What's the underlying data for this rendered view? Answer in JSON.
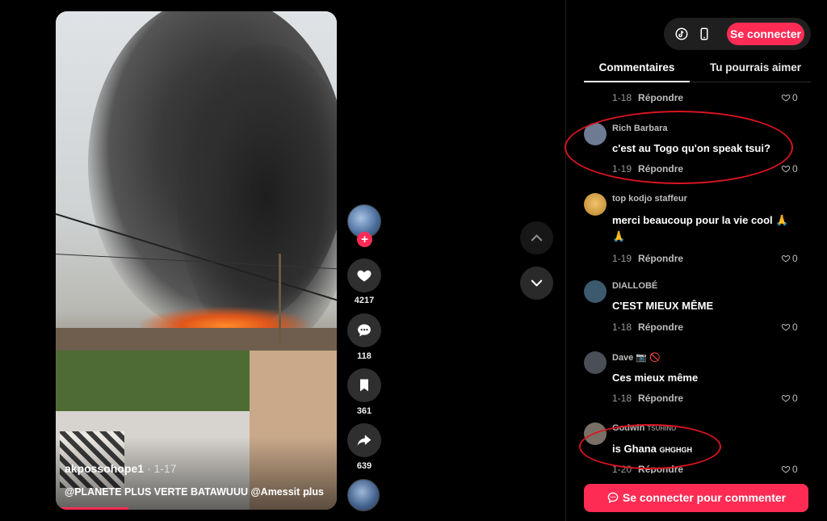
{
  "video": {
    "author": "akpossohope1",
    "date_sep": " · ",
    "date": "1-17",
    "caption": "@PLANETE PLUS VERTE BATAWUUU @Amessit ...",
    "more_label": "plus",
    "progress": 0.26
  },
  "actions": {
    "likes": "4217",
    "comments": "118",
    "saves": "361",
    "shares": "639",
    "follow_symbol": "+"
  },
  "header": {
    "connect_label": "Se connecter"
  },
  "tabs": [
    {
      "label": "Commentaires",
      "active": true
    },
    {
      "label": "Tu pourrais aimer",
      "active": false
    }
  ],
  "partial_top": {
    "date": "1-18",
    "reply": "Répondre",
    "likes": "0"
  },
  "comments": [
    {
      "name": "Rich Barbara",
      "text": "c'est au Togo qu'on speak tsui?",
      "date": "1-19",
      "reply": "Répondre",
      "likes": "0",
      "avatar_color": "#6d7c92"
    },
    {
      "name": "top kodjo staffeur",
      "text": "merci beaucoup pour la vie cool 🙏",
      "text2": "🙏",
      "date": "1-19",
      "reply": "Répondre",
      "likes": "0",
      "avatar_color": "#d9a441"
    },
    {
      "name": "DIALLOBÉ",
      "text": "C'EST MIEUX MÊME",
      "date": "1-18",
      "reply": "Répondre",
      "likes": "0",
      "avatar_color": "#3b5a6e"
    },
    {
      "name": "Dave 📷 🚫",
      "text": "Ces mieux même",
      "date": "1-18",
      "reply": "Répondre",
      "likes": "0",
      "avatar_color": "#4a4f57"
    },
    {
      "name": "Godwin",
      "name_suffix": "TSUHINO",
      "text": "is Ghana",
      "text_suffix": "GHGHGH",
      "date": "1-20",
      "reply": "Répondre",
      "likes": "0",
      "avatar_color": "#7a6f66"
    }
  ],
  "footer": {
    "login_to_comment": "Se connecter pour commenter"
  },
  "colors": {
    "accent": "#fe2c55",
    "annotation": "#d8141f"
  }
}
